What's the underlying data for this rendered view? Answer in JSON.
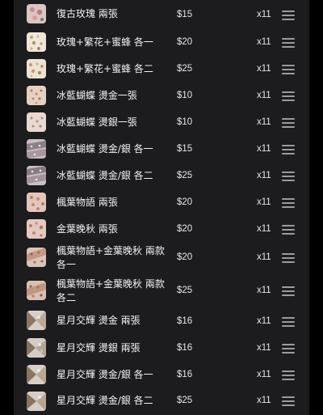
{
  "list": {
    "items": [
      {
        "name": "復古玫瑰 兩張",
        "price": "$15",
        "qty": "x11",
        "thumb": "thumb-pink-rose"
      },
      {
        "name": "玫瑰+繁花+蜜蜂 各一",
        "price": "$20",
        "qty": "x11",
        "thumb": "thumb-flower-bee"
      },
      {
        "name": "玫瑰+繁花+蜜蜂 各二",
        "price": "$25",
        "qty": "x11",
        "thumb": "thumb-flower-bee"
      },
      {
        "name": "冰藍蝴蝶 燙金一張",
        "price": "$10",
        "qty": "x11",
        "thumb": "thumb-butterfly-gold"
      },
      {
        "name": "冰藍蝴蝶 燙銀一張",
        "price": "$10",
        "qty": "x11",
        "thumb": "thumb-butterfly-silver"
      },
      {
        "name": "冰藍蝴蝶 燙金/銀 各一",
        "price": "$15",
        "qty": "x11",
        "thumb": "thumb-butterfly-mix"
      },
      {
        "name": "冰藍蝴蝶 燙金/銀 各二",
        "price": "$25",
        "qty": "x11",
        "thumb": "thumb-butterfly-mix"
      },
      {
        "name": "楓葉物語 兩張",
        "price": "$20",
        "qty": "x11",
        "thumb": "thumb-maple"
      },
      {
        "name": "金葉晚秋 兩張",
        "price": "$20",
        "qty": "x11",
        "thumb": "thumb-maple"
      },
      {
        "name": "楓葉物語+金葉晚秋 兩款各一",
        "price": "$20",
        "qty": "x11",
        "thumb": "thumb-leaf-mix"
      },
      {
        "name": "楓葉物語+金葉晚秋 兩款各二",
        "price": "$25",
        "qty": "x11",
        "thumb": "thumb-leaf-mix"
      },
      {
        "name": "星月交輝 燙金 兩張",
        "price": "$16",
        "qty": "x11",
        "thumb": "thumb-star-moon"
      },
      {
        "name": "星月交輝 燙銀 兩張",
        "price": "$16",
        "qty": "x11",
        "thumb": "thumb-star-moon"
      },
      {
        "name": "星月交輝 燙金/銀 各一",
        "price": "$16",
        "qty": "x11",
        "thumb": "thumb-star-moon"
      },
      {
        "name": "星月交輝 燙金/銀 各二",
        "price": "$25",
        "qty": "x11",
        "thumb": "thumb-star-moon"
      }
    ],
    "drag_handle_icon": "drag-handle-icon"
  },
  "colors": {
    "panel_bg": "#1c1c1f",
    "page_bg": "#000000",
    "text": "#f2f2f2",
    "handle": "#9a9aa0"
  }
}
